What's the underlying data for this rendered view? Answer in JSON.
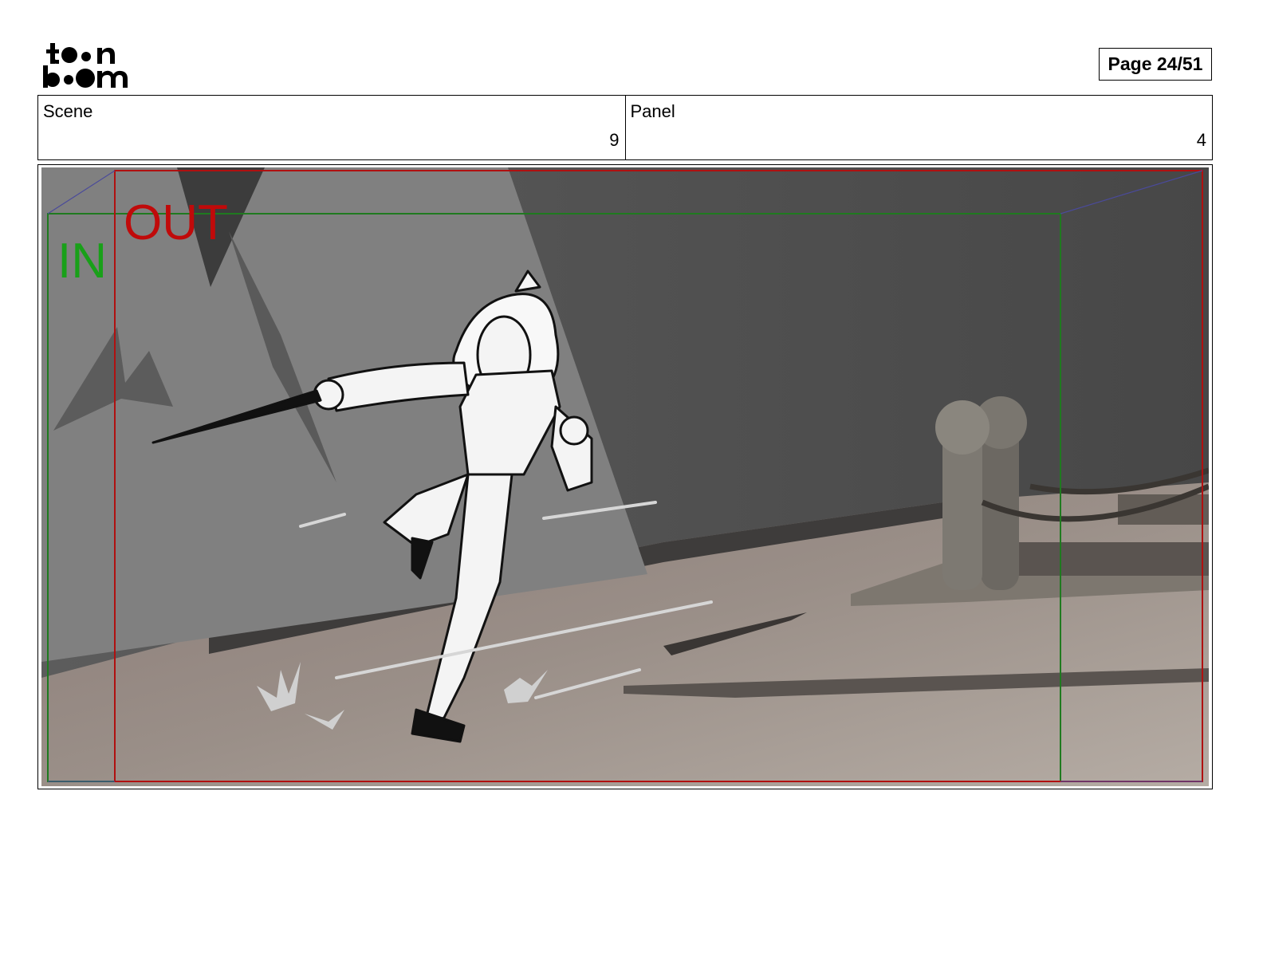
{
  "header": {
    "logo_alt": "toon boom",
    "page_label": "Page 24/51"
  },
  "info": {
    "scene_label": "Scene",
    "scene_value": "9",
    "panel_label": "Panel",
    "panel_value": "4"
  },
  "panel": {
    "in_label": "IN",
    "out_label": "OUT",
    "colors": {
      "in_frame": "#1f7a1f",
      "out_frame": "#b01010",
      "camera_path": "#4a4a9a"
    }
  }
}
